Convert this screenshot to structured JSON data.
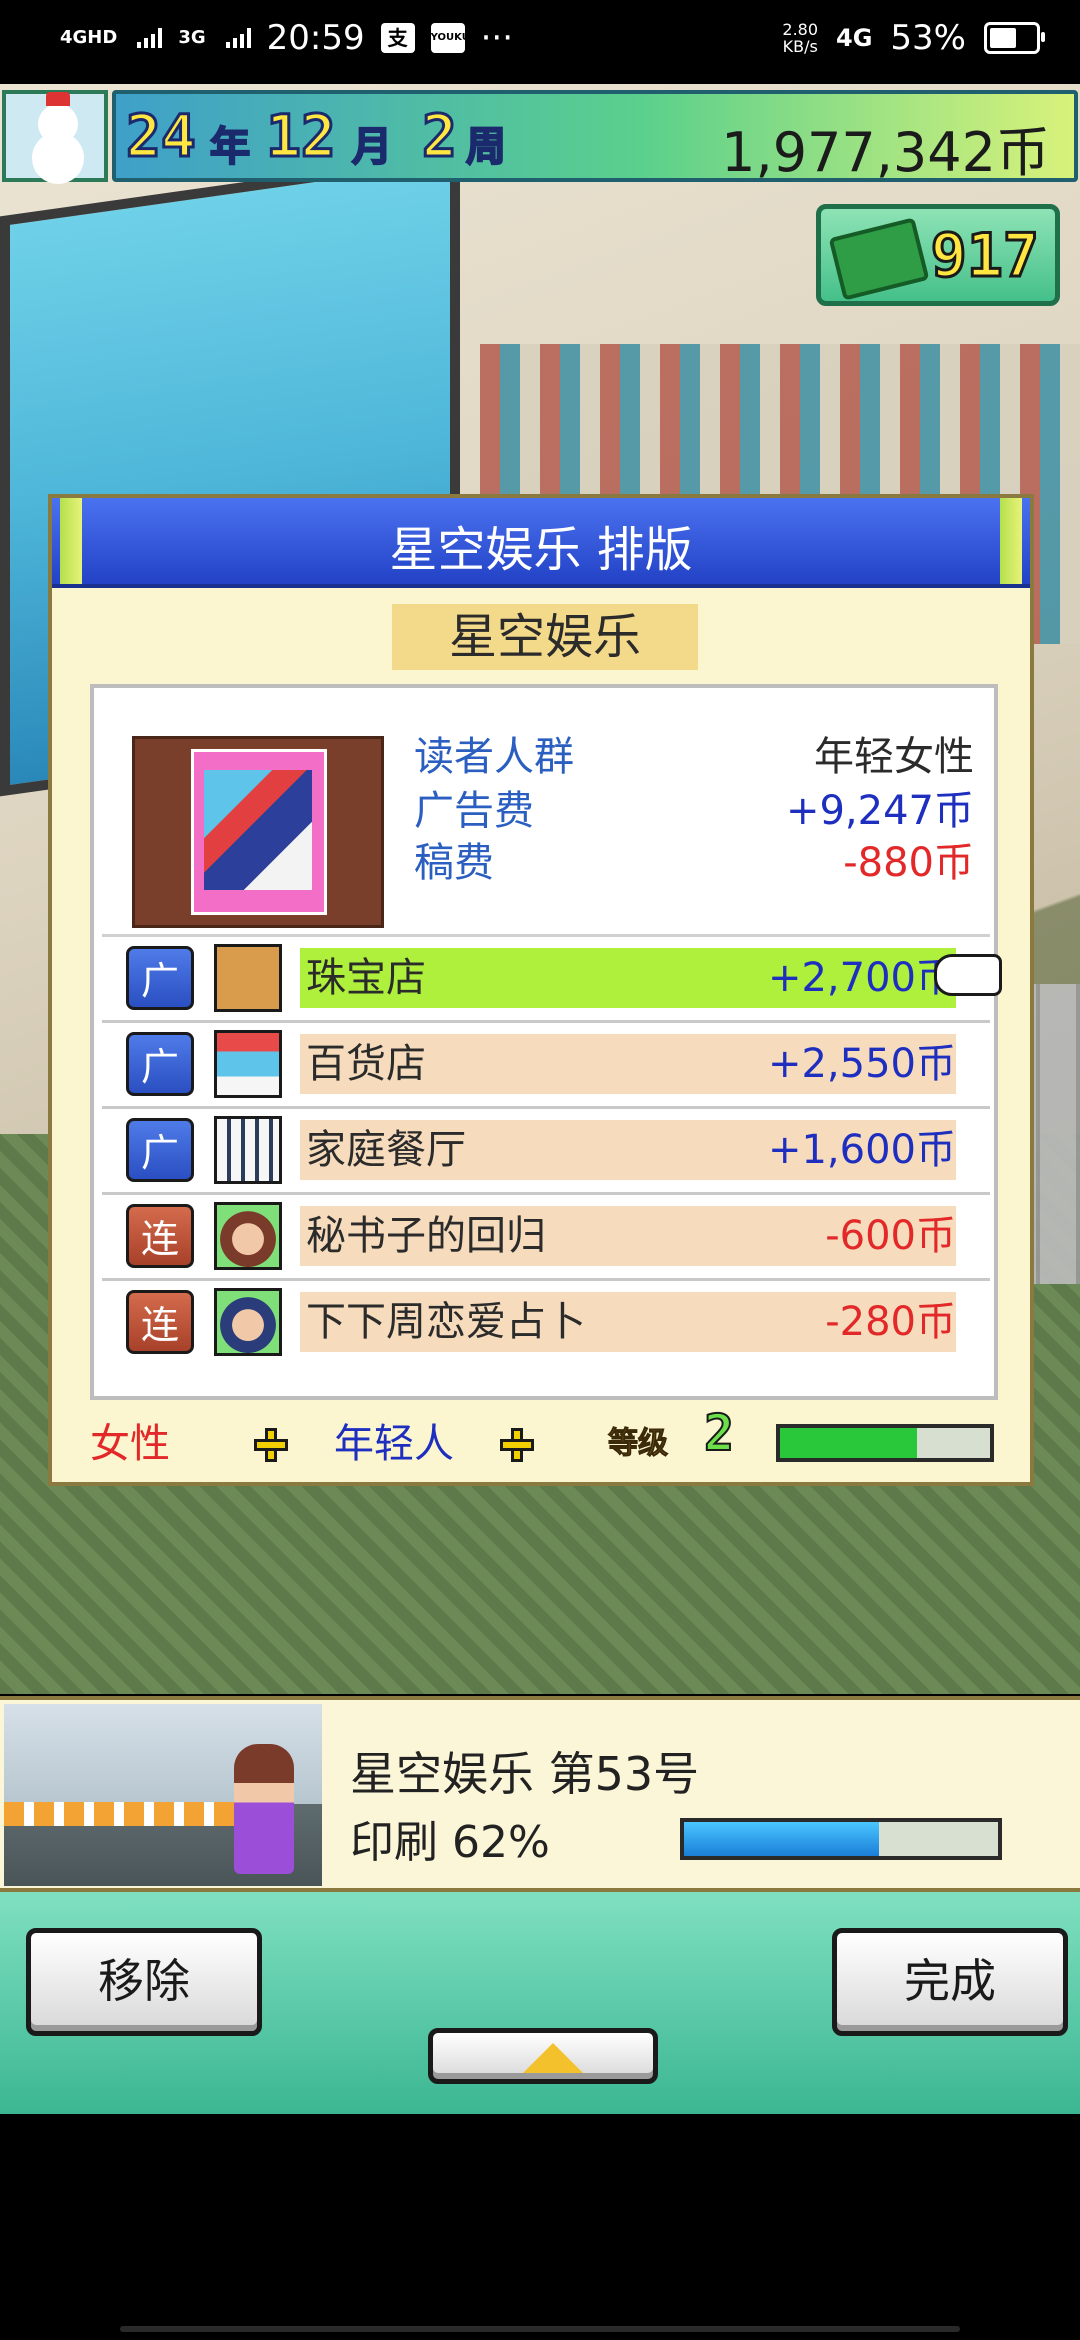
{
  "status_bar": {
    "network1": "4GHD",
    "network2": "3G",
    "time": "20:59",
    "app_icon1": "支",
    "app_icon2": "YOUKU",
    "more": "···",
    "speed_value": "2.80",
    "speed_unit": "KB/s",
    "network3": "4G",
    "battery": "53%"
  },
  "top_bar": {
    "year": "24",
    "year_unit": "年",
    "month": "12",
    "month_unit": "月",
    "week": "2",
    "week_unit": "周",
    "money": "1,977,342币",
    "cash_count": "917"
  },
  "dialog": {
    "title": "星空娱乐 排版",
    "magazine_name": "星空娱乐",
    "info": [
      {
        "label": "读者人群",
        "value": "年轻女性",
        "color": "#2b2b2b"
      },
      {
        "label": "广告费",
        "value": "+9,247币",
        "color": "#1e2fc0"
      },
      {
        "label": "稿费",
        "value": "-880币",
        "color": "#e22828"
      }
    ],
    "items": [
      {
        "tag": "广",
        "name": "珠宝店",
        "value": "+2,700币",
        "type": "ad",
        "selected": true
      },
      {
        "tag": "广",
        "name": "百货店",
        "value": "+2,550币",
        "type": "ad",
        "selected": false
      },
      {
        "tag": "广",
        "name": "家庭餐厅",
        "value": "+1,600币",
        "type": "ad",
        "selected": false
      },
      {
        "tag": "连",
        "name": "秘书子的回归",
        "value": "-600币",
        "type": "serial",
        "selected": false
      },
      {
        "tag": "连",
        "name": "下下周恋爱占卜",
        "value": "-280币",
        "type": "serial",
        "selected": false
      }
    ],
    "footer": {
      "tag1": "女性",
      "tag2": "年轻人",
      "level_label": "等级",
      "level": "2",
      "level_progress": 0.65
    }
  },
  "printing": {
    "title": "星空娱乐 第53号",
    "status": "印刷 62%",
    "progress": 0.62
  },
  "buttons": {
    "remove": "移除",
    "done": "完成"
  }
}
